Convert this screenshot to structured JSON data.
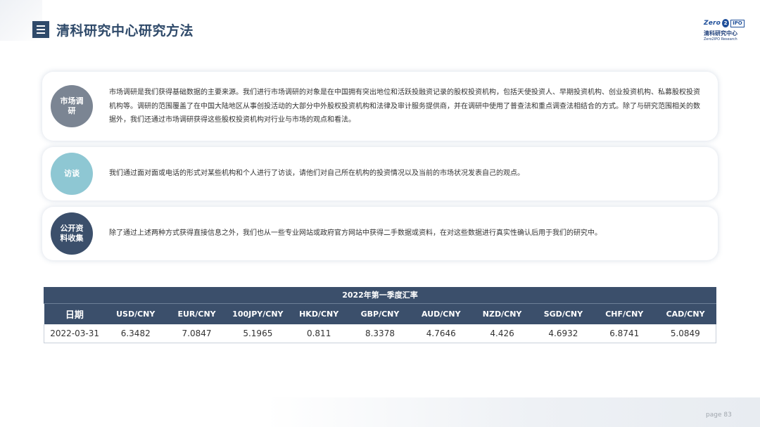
{
  "header": {
    "title": "清科研究中心研究方法",
    "menu_icon": "menu-icon"
  },
  "logo": {
    "brand_latin_1": "Zero",
    "brand_mark": "2",
    "brand_latin_2": "IPO",
    "brand_cn": "清科研究中心",
    "brand_en": "Zero2IPO Research"
  },
  "methods": [
    {
      "label": "市场调研",
      "text": "市场调研是我们获得基础数据的主要来源。我们进行市场调研的对象是在中国拥有突出地位和活跃投融资记录的股权投资机构，包括天使投资人、早期投资机构、创业投资机构、私募股权投资机构等。调研的范围覆盖了在中国大陆地区从事创投活动的大部分中外股权投资机构和法律及审计服务提供商，并在调研中使用了普查法和重点调查法相结合的方式。除了与研究范围相关的数据外，我们还通过市场调研获得这些股权投资机构对行业与市场的观点和看法。"
    },
    {
      "label": "访谈",
      "text": "我们通过面对面或电话的形式对某些机构和个人进行了访谈，请他们对自己所在机构的投资情况以及当前的市场状况发表自己的观点。"
    },
    {
      "label": "公开资料收集",
      "text": "除了通过上述两种方式获得直接信息之外，我们也从一些专业网站或政府官方网站中获得二手数据或资料，在对这些数据进行真实性确认后用于我们的研究中。"
    }
  ],
  "rates_table": {
    "title": "2022年第一季度汇率",
    "headers": [
      "日期",
      "USD/CNY",
      "EUR/CNY",
      "100JPY/CNY",
      "HKD/CNY",
      "GBP/CNY",
      "AUD/CNY",
      "NZD/CNY",
      "SGD/CNY",
      "CHF/CNY",
      "CAD/CNY"
    ],
    "rows": [
      [
        "2022-03-31",
        "6.3482",
        "7.0847",
        "5.1965",
        "0.811",
        "8.3378",
        "4.7646",
        "4.426",
        "4.6932",
        "6.8741",
        "5.0849"
      ]
    ]
  },
  "footer": {
    "page_label": "page",
    "page_number": "83"
  },
  "colors": {
    "navy": "#3b4f6b",
    "title_blue": "#2f4a6a",
    "badge_grey": "#7b8593",
    "badge_teal": "#8ec7d3",
    "logo_blue": "#1f4f9a"
  }
}
